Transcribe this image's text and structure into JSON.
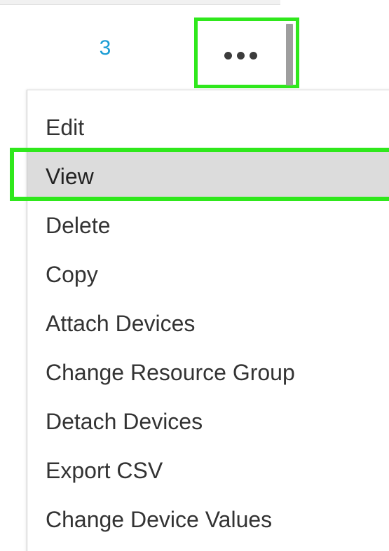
{
  "table_row": {
    "count": "3"
  },
  "more_button": {
    "icon": "more-horizontal-icon",
    "highlight_color": "#2fe81c"
  },
  "menu": {
    "items": [
      {
        "label": "Edit"
      },
      {
        "label": "View",
        "selected": true
      },
      {
        "label": "Delete"
      },
      {
        "label": "Copy"
      },
      {
        "label": "Attach Devices"
      },
      {
        "label": "Change Resource Group"
      },
      {
        "label": "Detach Devices"
      },
      {
        "label": "Export CSV"
      },
      {
        "label": "Change Device Values"
      }
    ]
  },
  "colors": {
    "count_text": "#1a9cd4",
    "highlight": "#2fe81c",
    "selected_bg": "#dcdcdc"
  }
}
